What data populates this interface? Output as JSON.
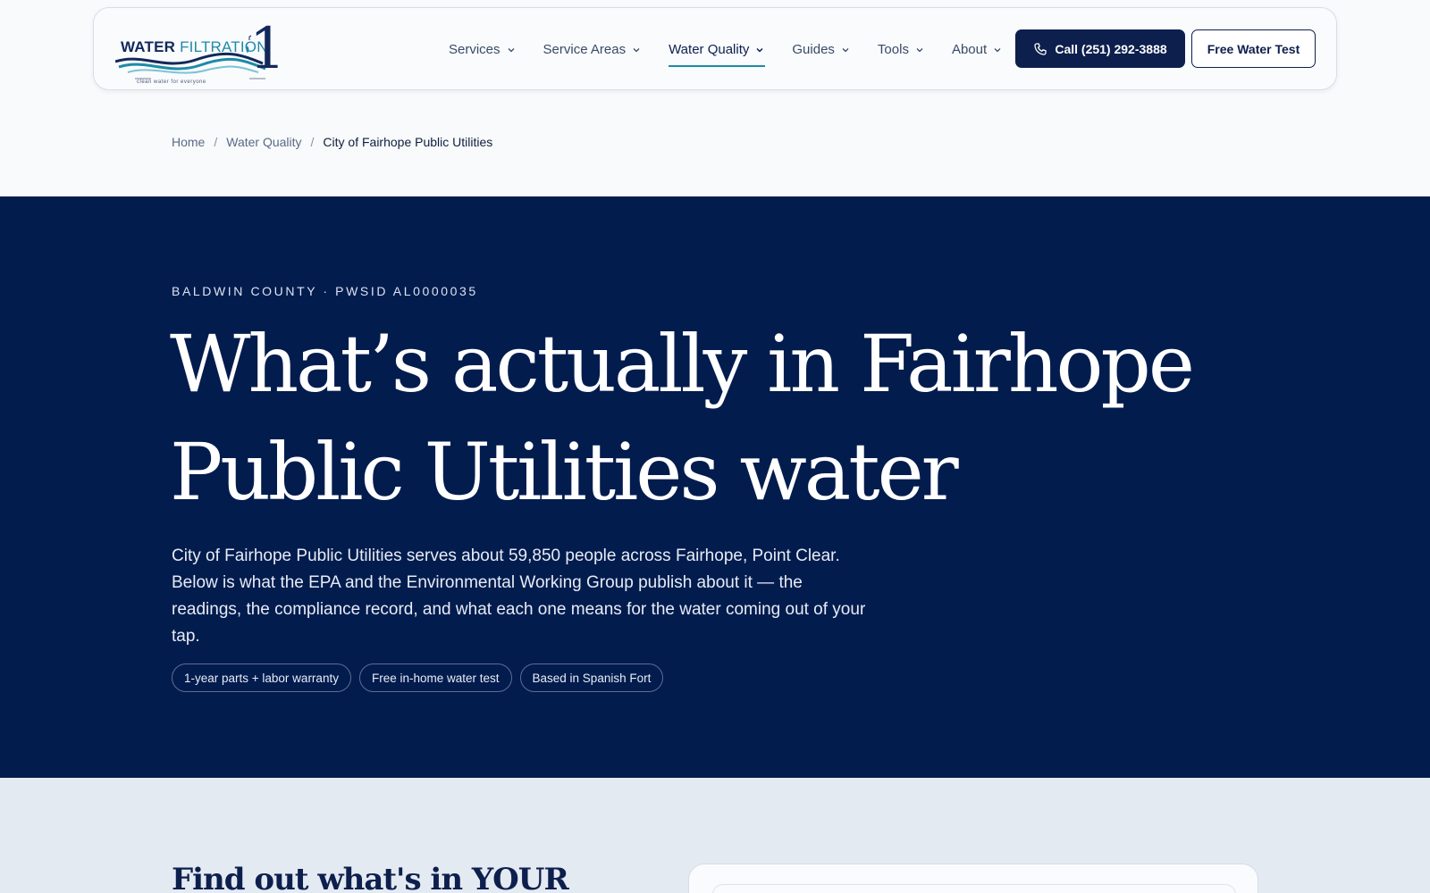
{
  "header": {
    "logo": {
      "word_water": "WATER",
      "word_filtration": "FILTRATION",
      "numeral": "1",
      "tagline": "clean water for everyone"
    },
    "nav": [
      {
        "label": "Services",
        "active": false
      },
      {
        "label": "Service Areas",
        "active": false
      },
      {
        "label": "Water Quality",
        "active": true
      },
      {
        "label": "Guides",
        "active": false
      },
      {
        "label": "Tools",
        "active": false
      },
      {
        "label": "About",
        "active": false
      }
    ],
    "call_label": "Call (251) 292-3888",
    "test_label": "Free Water Test"
  },
  "breadcrumb": {
    "home": "Home",
    "section": "Water Quality",
    "current": "City of Fairhope Public Utilities",
    "separator": "/"
  },
  "hero": {
    "eyebrow": "BALDWIN COUNTY · PWSID AL0000035",
    "title": "What’s actually in Fairhope Public Utilities water",
    "description": "City of Fairhope Public Utilities serves about 59,850 people across Fairhope, Point Clear. Below is what the EPA and the Environmental Working Group publish about it — the readings, the compliance record, and what each one means for the water coming out of your tap.",
    "pills": [
      "1-year parts + labor warranty",
      "Free in-home water test",
      "Based in Spanish Fort"
    ]
  },
  "lower": {
    "title": "Find out what's in YOUR"
  },
  "colors": {
    "navy": "#031c4e",
    "button_navy": "#0d1f4d",
    "accent_teal": "#1f8aa6",
    "page_bg": "#f8fafc",
    "lower_bg": "#e4eaf2"
  }
}
